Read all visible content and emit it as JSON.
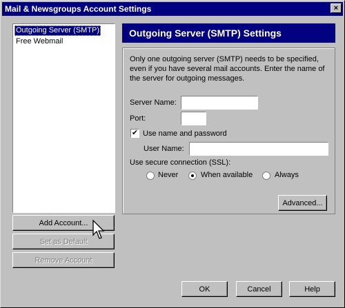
{
  "window": {
    "title": "Mail & Newsgroups Account Settings",
    "close_glyph": "×"
  },
  "accounts": [
    {
      "label": "Outgoing Server (SMTP)",
      "selected": true
    },
    {
      "label": "Free Webmail",
      "selected": false
    }
  ],
  "left_buttons": {
    "add_account": "Add Account...",
    "set_default": "Set as Default",
    "remove_account": "Remove Account"
  },
  "panel": {
    "header": "Outgoing Server (SMTP) Settings",
    "description": "Only one outgoing server (SMTP) needs to be specified, even if you have several mail accounts. Enter the name of the server for outgoing messages.",
    "server_name_label": "Server Name:",
    "server_name_value": "",
    "port_label": "Port:",
    "port_value": "",
    "use_name_password_label": "Use name and password",
    "use_name_password_checked": true,
    "user_name_label": "User Name:",
    "user_name_value": "",
    "ssl_label": "Use secure connection (SSL):",
    "ssl_options": [
      {
        "label": "Never",
        "selected": false
      },
      {
        "label": "When available",
        "selected": true
      },
      {
        "label": "Always",
        "selected": false
      }
    ],
    "advanced_button": "Advanced..."
  },
  "footer_buttons": {
    "ok": "OK",
    "cancel": "Cancel",
    "help": "Help"
  },
  "colors": {
    "titlebar": "#000080",
    "face": "#c0c0c0"
  }
}
